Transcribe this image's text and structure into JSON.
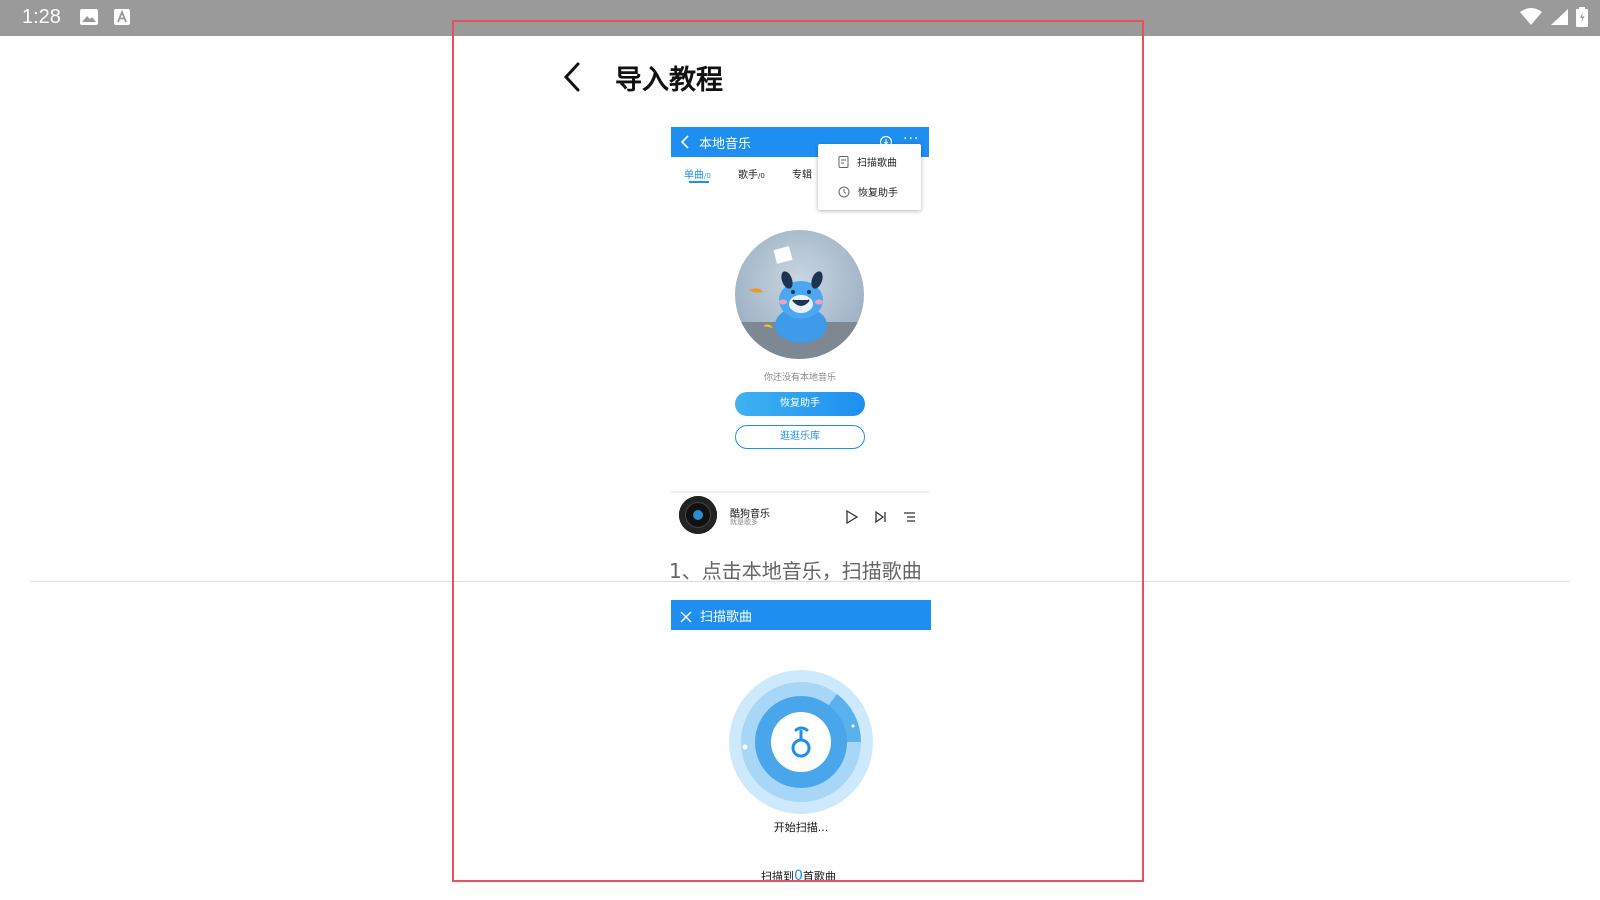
{
  "status_bar": {
    "time": "1:28"
  },
  "header": {
    "title": "导入教程"
  },
  "step1": {
    "app_bar_title": "本地音乐",
    "tabs": [
      {
        "label": "单曲",
        "count": "/0"
      },
      {
        "label": "歌手",
        "count": "/0"
      },
      {
        "label": "专辑",
        "count": ""
      }
    ],
    "menu": {
      "scan": "扫描歌曲",
      "restore": "恢复助手"
    },
    "empty_text": "你还没有本地音乐",
    "restore_button": "恢复助手",
    "browse_button": "逛逛乐库",
    "player": {
      "title": "酷狗音乐",
      "subtitle": "就是歌多"
    },
    "caption": "1、点击本地音乐，扫描歌曲"
  },
  "step2": {
    "app_bar_title": "扫描歌曲",
    "start_text": "开始扫描...",
    "found_prefix": "扫描到",
    "found_count": "0",
    "found_suffix": "首歌曲"
  },
  "colors": {
    "accent": "#1e8ff0",
    "highlight_border": "#e8505b",
    "status_bar": "#9a9a9a"
  }
}
